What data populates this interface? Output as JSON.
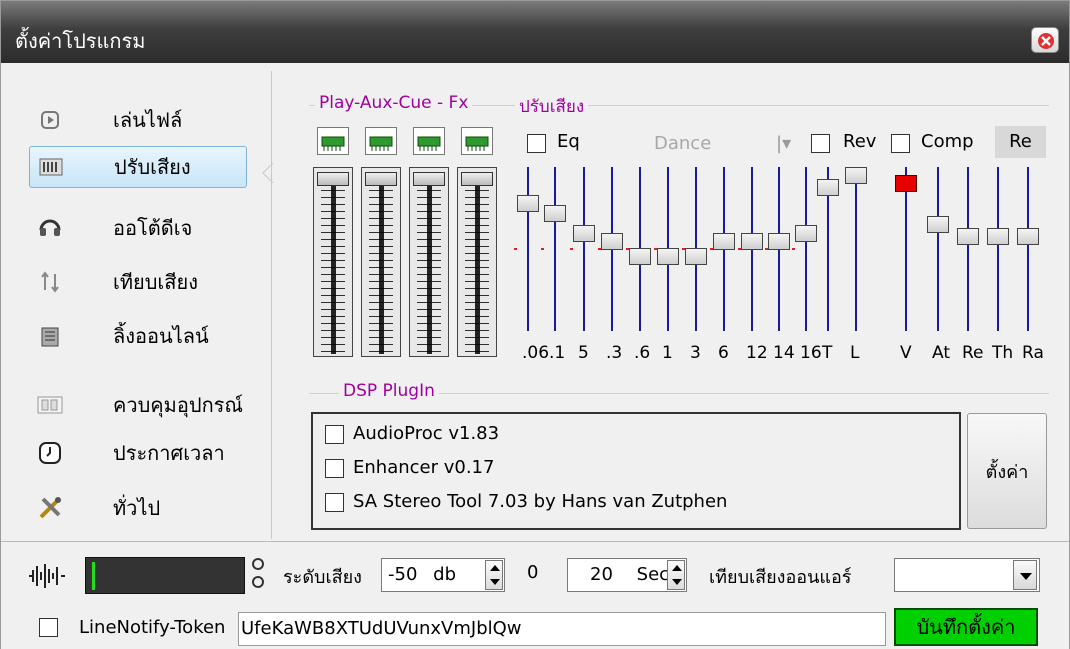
{
  "window": {
    "title": "ตั้งค่าโปรแกรม",
    "close_icon": "close-icon"
  },
  "sidebar": {
    "items": [
      {
        "label": "เล่นไฟล์",
        "icon": "play-file-icon",
        "active": false
      },
      {
        "label": "ปรับเสียง",
        "icon": "equalizer-icon",
        "active": true
      },
      {
        "label": "ออโต้ดีเจ",
        "icon": "dj-headphones-icon",
        "active": false
      },
      {
        "label": "เทียบเสียง",
        "icon": "sync-icon",
        "active": false
      },
      {
        "label": "ลิ้งออนไลน์",
        "icon": "online-link-icon",
        "active": false
      },
      {
        "label": "ควบคุมอุปกรณ์",
        "icon": "device-control-icon",
        "active": false
      },
      {
        "label": "ประกาศเวลา",
        "icon": "clock-icon",
        "active": false
      },
      {
        "label": "ทั่วไป",
        "icon": "tools-icon",
        "active": false
      }
    ]
  },
  "groups": {
    "mixer": "Play-Aux-Cue - Fx",
    "adjust": "ปรับเสียง",
    "dsp": "DSP PlugIn"
  },
  "mixer_channels": [
    "Play",
    "Aux",
    "Cue",
    "Fx"
  ],
  "eq": {
    "eq_label": "Eq",
    "eq_checked": false,
    "preset": "Dance",
    "rev_label": "Rev",
    "rev_checked": false,
    "comp_label": "Comp",
    "comp_checked": false,
    "reset_label": "Re",
    "bands": [
      {
        "label": ".06",
        "level": 0.78
      },
      {
        "label": ".1",
        "level": 0.72
      },
      {
        "label": "5",
        "level": 0.6
      },
      {
        "label": ".3",
        "level": 0.55
      },
      {
        "label": ".6",
        "level": 0.46
      },
      {
        "label": "1",
        "level": 0.46
      },
      {
        "label": "3",
        "level": 0.46
      },
      {
        "label": "6",
        "level": 0.55
      },
      {
        "label": "12",
        "level": 0.55
      },
      {
        "label": "14",
        "level": 0.55
      },
      {
        "label": "16",
        "level": 0.6
      }
    ],
    "reverb": [
      {
        "label": "T",
        "level": 0.88
      },
      {
        "label": "L",
        "level": 0.95
      }
    ],
    "comp": [
      {
        "label": "V",
        "level": 0.9,
        "active": true
      },
      {
        "label": "At",
        "level": 0.65
      },
      {
        "label": "Re",
        "level": 0.58
      },
      {
        "label": "Th",
        "level": 0.58
      },
      {
        "label": "Ra",
        "level": 0.58
      }
    ]
  },
  "dsp_plugins": [
    {
      "label": "AudioProc v1.83",
      "checked": false
    },
    {
      "label": "Enhancer v0.17",
      "checked": false
    },
    {
      "label": "SA Stereo Tool 7.03 by Hans van Zutphen",
      "checked": false
    }
  ],
  "dsp_settings_label": "ตั้งค่า",
  "bottom": {
    "level_label": "ระดับเสียง",
    "level_value": "-50",
    "level_unit": "db",
    "zero_label": "0",
    "sec_value": "20",
    "sec_unit": "Sec",
    "compare_label": "เทียบเสียงออนแอร์",
    "compare_value": "",
    "token_checked": false,
    "token_label": "LineNotify-Token",
    "token_value": "UfeKaWB8XTUdUVunxVmJblQw",
    "save_label": "บันทึกตั้งค่า"
  }
}
